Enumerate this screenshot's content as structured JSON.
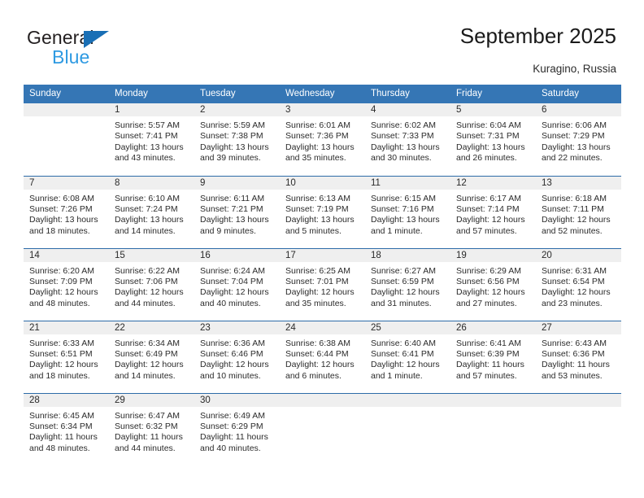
{
  "brand": {
    "name_top": "General",
    "name_bottom": "Blue",
    "triangle_color": "#1a6fb5",
    "blue_text_color": "#2e9ae2"
  },
  "header": {
    "title": "September 2025",
    "subtitle": "Kuragino, Russia",
    "header_bg": "#3576b5",
    "daynum_bg": "#efefef"
  },
  "columns": [
    "Sunday",
    "Monday",
    "Tuesday",
    "Wednesday",
    "Thursday",
    "Friday",
    "Saturday"
  ],
  "labels": {
    "sunrise_prefix": "Sunrise:",
    "sunset_prefix": "Sunset:",
    "daylight_prefix": "Daylight:"
  },
  "weeks": [
    [
      {
        "day": ""
      },
      {
        "day": "1",
        "sunrise": "Sunrise: 5:57 AM",
        "sunset": "Sunset: 7:41 PM",
        "daylight": "Daylight: 13 hours and 43 minutes."
      },
      {
        "day": "2",
        "sunrise": "Sunrise: 5:59 AM",
        "sunset": "Sunset: 7:38 PM",
        "daylight": "Daylight: 13 hours and 39 minutes."
      },
      {
        "day": "3",
        "sunrise": "Sunrise: 6:01 AM",
        "sunset": "Sunset: 7:36 PM",
        "daylight": "Daylight: 13 hours and 35 minutes."
      },
      {
        "day": "4",
        "sunrise": "Sunrise: 6:02 AM",
        "sunset": "Sunset: 7:33 PM",
        "daylight": "Daylight: 13 hours and 30 minutes."
      },
      {
        "day": "5",
        "sunrise": "Sunrise: 6:04 AM",
        "sunset": "Sunset: 7:31 PM",
        "daylight": "Daylight: 13 hours and 26 minutes."
      },
      {
        "day": "6",
        "sunrise": "Sunrise: 6:06 AM",
        "sunset": "Sunset: 7:29 PM",
        "daylight": "Daylight: 13 hours and 22 minutes."
      }
    ],
    [
      {
        "day": "7",
        "sunrise": "Sunrise: 6:08 AM",
        "sunset": "Sunset: 7:26 PM",
        "daylight": "Daylight: 13 hours and 18 minutes."
      },
      {
        "day": "8",
        "sunrise": "Sunrise: 6:10 AM",
        "sunset": "Sunset: 7:24 PM",
        "daylight": "Daylight: 13 hours and 14 minutes."
      },
      {
        "day": "9",
        "sunrise": "Sunrise: 6:11 AM",
        "sunset": "Sunset: 7:21 PM",
        "daylight": "Daylight: 13 hours and 9 minutes."
      },
      {
        "day": "10",
        "sunrise": "Sunrise: 6:13 AM",
        "sunset": "Sunset: 7:19 PM",
        "daylight": "Daylight: 13 hours and 5 minutes."
      },
      {
        "day": "11",
        "sunrise": "Sunrise: 6:15 AM",
        "sunset": "Sunset: 7:16 PM",
        "daylight": "Daylight: 13 hours and 1 minute."
      },
      {
        "day": "12",
        "sunrise": "Sunrise: 6:17 AM",
        "sunset": "Sunset: 7:14 PM",
        "daylight": "Daylight: 12 hours and 57 minutes."
      },
      {
        "day": "13",
        "sunrise": "Sunrise: 6:18 AM",
        "sunset": "Sunset: 7:11 PM",
        "daylight": "Daylight: 12 hours and 52 minutes."
      }
    ],
    [
      {
        "day": "14",
        "sunrise": "Sunrise: 6:20 AM",
        "sunset": "Sunset: 7:09 PM",
        "daylight": "Daylight: 12 hours and 48 minutes."
      },
      {
        "day": "15",
        "sunrise": "Sunrise: 6:22 AM",
        "sunset": "Sunset: 7:06 PM",
        "daylight": "Daylight: 12 hours and 44 minutes."
      },
      {
        "day": "16",
        "sunrise": "Sunrise: 6:24 AM",
        "sunset": "Sunset: 7:04 PM",
        "daylight": "Daylight: 12 hours and 40 minutes."
      },
      {
        "day": "17",
        "sunrise": "Sunrise: 6:25 AM",
        "sunset": "Sunset: 7:01 PM",
        "daylight": "Daylight: 12 hours and 35 minutes."
      },
      {
        "day": "18",
        "sunrise": "Sunrise: 6:27 AM",
        "sunset": "Sunset: 6:59 PM",
        "daylight": "Daylight: 12 hours and 31 minutes."
      },
      {
        "day": "19",
        "sunrise": "Sunrise: 6:29 AM",
        "sunset": "Sunset: 6:56 PM",
        "daylight": "Daylight: 12 hours and 27 minutes."
      },
      {
        "day": "20",
        "sunrise": "Sunrise: 6:31 AM",
        "sunset": "Sunset: 6:54 PM",
        "daylight": "Daylight: 12 hours and 23 minutes."
      }
    ],
    [
      {
        "day": "21",
        "sunrise": "Sunrise: 6:33 AM",
        "sunset": "Sunset: 6:51 PM",
        "daylight": "Daylight: 12 hours and 18 minutes."
      },
      {
        "day": "22",
        "sunrise": "Sunrise: 6:34 AM",
        "sunset": "Sunset: 6:49 PM",
        "daylight": "Daylight: 12 hours and 14 minutes."
      },
      {
        "day": "23",
        "sunrise": "Sunrise: 6:36 AM",
        "sunset": "Sunset: 6:46 PM",
        "daylight": "Daylight: 12 hours and 10 minutes."
      },
      {
        "day": "24",
        "sunrise": "Sunrise: 6:38 AM",
        "sunset": "Sunset: 6:44 PM",
        "daylight": "Daylight: 12 hours and 6 minutes."
      },
      {
        "day": "25",
        "sunrise": "Sunrise: 6:40 AM",
        "sunset": "Sunset: 6:41 PM",
        "daylight": "Daylight: 12 hours and 1 minute."
      },
      {
        "day": "26",
        "sunrise": "Sunrise: 6:41 AM",
        "sunset": "Sunset: 6:39 PM",
        "daylight": "Daylight: 11 hours and 57 minutes."
      },
      {
        "day": "27",
        "sunrise": "Sunrise: 6:43 AM",
        "sunset": "Sunset: 6:36 PM",
        "daylight": "Daylight: 11 hours and 53 minutes."
      }
    ],
    [
      {
        "day": "28",
        "sunrise": "Sunrise: 6:45 AM",
        "sunset": "Sunset: 6:34 PM",
        "daylight": "Daylight: 11 hours and 48 minutes."
      },
      {
        "day": "29",
        "sunrise": "Sunrise: 6:47 AM",
        "sunset": "Sunset: 6:32 PM",
        "daylight": "Daylight: 11 hours and 44 minutes."
      },
      {
        "day": "30",
        "sunrise": "Sunrise: 6:49 AM",
        "sunset": "Sunset: 6:29 PM",
        "daylight": "Daylight: 11 hours and 40 minutes."
      },
      {
        "day": ""
      },
      {
        "day": ""
      },
      {
        "day": ""
      },
      {
        "day": ""
      }
    ]
  ]
}
